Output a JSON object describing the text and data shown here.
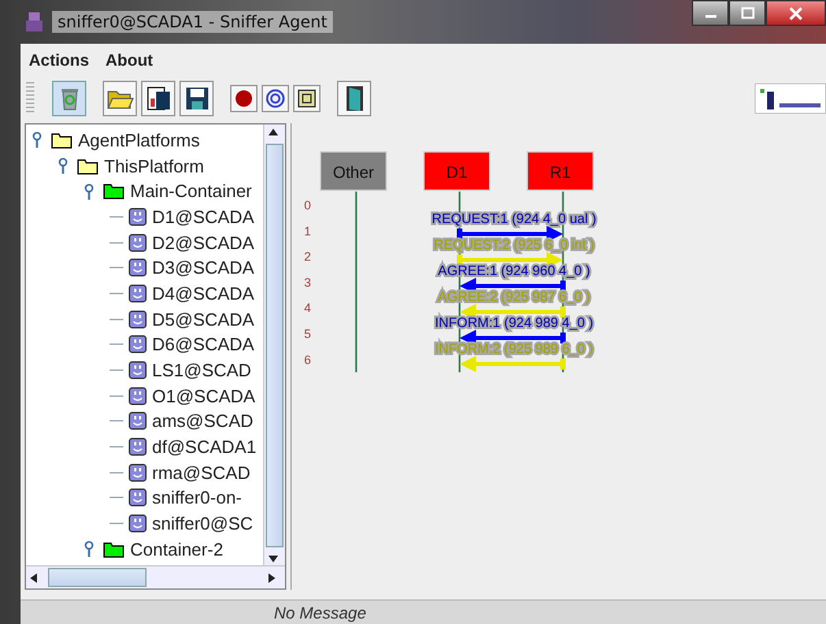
{
  "window": {
    "title": "sniffer0@SCADA1 - Sniffer Agent"
  },
  "menu": [
    "Actions",
    "About"
  ],
  "tree": [
    {
      "label": "AgentPlatforms",
      "kind": "platform",
      "expanded": true,
      "children": [
        {
          "label": "ThisPlatform",
          "kind": "platform",
          "expanded": true,
          "children": [
            {
              "label": "Main-Container",
              "kind": "container",
              "expanded": true,
              "children": [
                {
                  "label": "D1@SCADA",
                  "kind": "agent"
                },
                {
                  "label": "D2@SCADA",
                  "kind": "agent"
                },
                {
                  "label": "D3@SCADA",
                  "kind": "agent"
                },
                {
                  "label": "D4@SCADA",
                  "kind": "agent"
                },
                {
                  "label": "D5@SCADA",
                  "kind": "agent"
                },
                {
                  "label": "D6@SCADA",
                  "kind": "agent"
                },
                {
                  "label": "LS1@SCAD",
                  "kind": "agent"
                },
                {
                  "label": "O1@SCADA",
                  "kind": "agent"
                },
                {
                  "label": "ams@SCAD",
                  "kind": "agent"
                },
                {
                  "label": "df@SCADA1",
                  "kind": "agent"
                },
                {
                  "label": "rma@SCAD",
                  "kind": "agent"
                },
                {
                  "label": "sniffer0-on-",
                  "kind": "agent"
                },
                {
                  "label": "sniffer0@SC",
                  "kind": "agent"
                }
              ]
            },
            {
              "label": "Container-2",
              "kind": "container",
              "expanded": true
            }
          ]
        }
      ]
    }
  ],
  "agents": [
    {
      "label": "Other",
      "kind": "other"
    },
    {
      "label": "D1",
      "kind": "sniffed"
    },
    {
      "label": "R1",
      "kind": "sniffed"
    }
  ],
  "row_numbers": [
    "0",
    "1",
    "2",
    "3",
    "4",
    "5",
    "6"
  ],
  "messages": [
    {
      "label": "REQUEST:1 (924 4_0 ual )",
      "color": "#0000ff",
      "kind": "rightward"
    },
    {
      "label": "REQUEST:2 (925 6_0 int )",
      "color": "#e8e800",
      "kind": "rightward"
    },
    {
      "label": "AGREE:1 (924 960 4_0 )",
      "color": "#0000ff",
      "kind": "leftward"
    },
    {
      "label": "AGREE:2 (925 987 6_0 )",
      "color": "#e8e800",
      "kind": "leftward"
    },
    {
      "label": "INFORM:1 (924 989 4_0 )",
      "color": "#0000ff",
      "kind": "leftward"
    },
    {
      "label": "INFORM:2 (925 989 6_0 )",
      "color": "#e8e800",
      "kind": "leftward"
    }
  ],
  "status_bar": "No Message"
}
